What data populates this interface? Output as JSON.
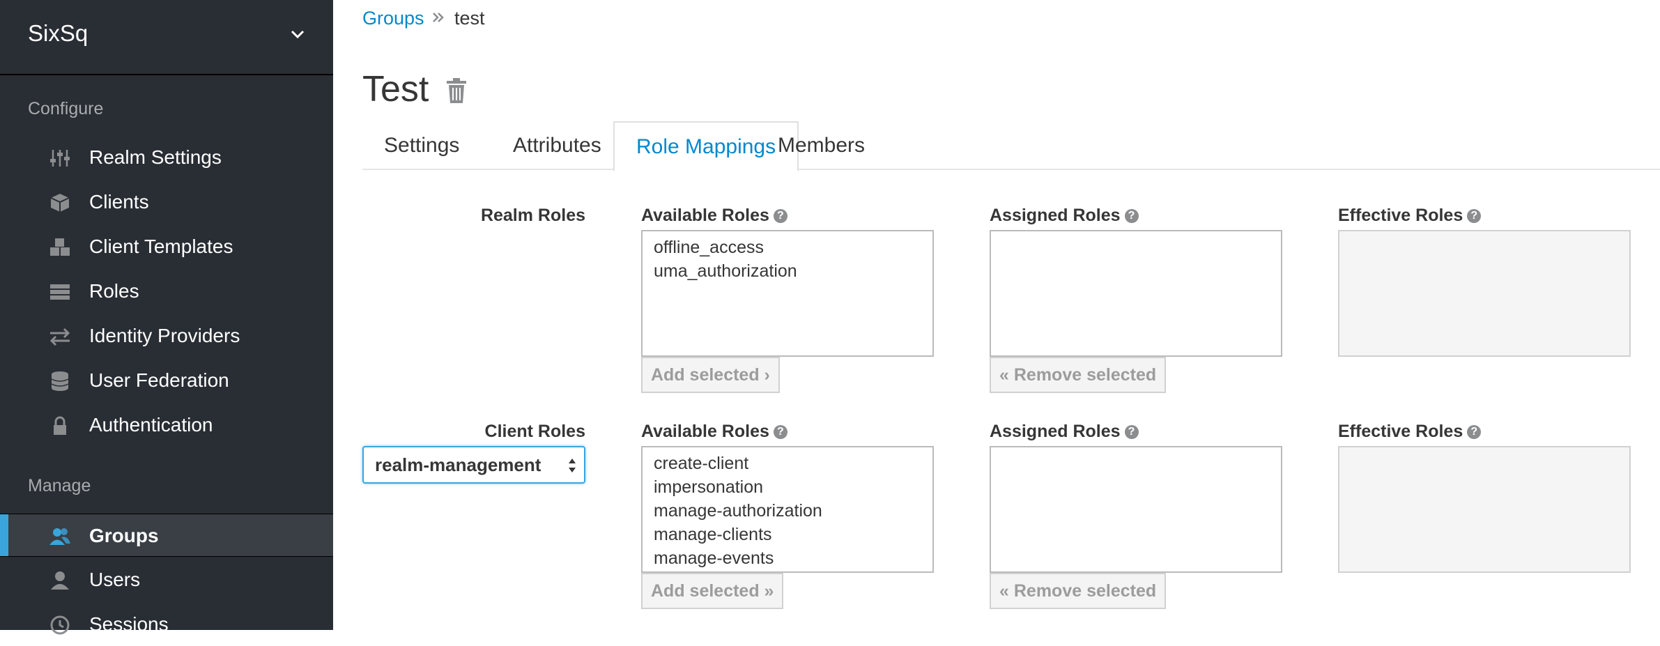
{
  "sidebar": {
    "realm_name": "SixSq",
    "configure_title": "Configure",
    "configure_items": [
      {
        "label": "Realm Settings",
        "icon": "sliders-icon"
      },
      {
        "label": "Clients",
        "icon": "cube-icon"
      },
      {
        "label": "Client Templates",
        "icon": "cubes-icon"
      },
      {
        "label": "Roles",
        "icon": "list-icon"
      },
      {
        "label": "Identity Providers",
        "icon": "exchange-icon"
      },
      {
        "label": "User Federation",
        "icon": "database-icon"
      },
      {
        "label": "Authentication",
        "icon": "lock-icon"
      }
    ],
    "manage_title": "Manage",
    "manage_items": [
      {
        "label": "Groups",
        "icon": "users-icon",
        "active": true
      },
      {
        "label": "Users",
        "icon": "user-icon"
      },
      {
        "label": "Sessions",
        "icon": "clock-icon"
      }
    ]
  },
  "breadcrumb": {
    "parent": "Groups",
    "current": "test"
  },
  "page": {
    "title": "Test"
  },
  "tabs": [
    {
      "label": "Settings"
    },
    {
      "label": "Attributes"
    },
    {
      "label": "Role Mappings",
      "active": true
    },
    {
      "label": "Members"
    }
  ],
  "realm_roles": {
    "label": "Realm Roles",
    "available_title": "Available Roles",
    "assigned_title": "Assigned Roles",
    "effective_title": "Effective Roles",
    "available": [
      "offline_access",
      "uma_authorization"
    ],
    "assigned": [],
    "effective": [],
    "add_label": "Add selected",
    "remove_label": "Remove selected"
  },
  "client_roles": {
    "label": "Client Roles",
    "client_selected": "realm-management",
    "available_title": "Available Roles",
    "assigned_title": "Assigned Roles",
    "effective_title": "Effective Roles",
    "available": [
      "create-client",
      "impersonation",
      "manage-authorization",
      "manage-clients",
      "manage-events"
    ],
    "assigned": [],
    "effective": [],
    "add_label": "Add selected",
    "remove_label": "Remove selected"
  },
  "colors": {
    "accent": "#0088ce",
    "sidebar_bg": "#292e34",
    "active_bar": "#39a5dc"
  }
}
